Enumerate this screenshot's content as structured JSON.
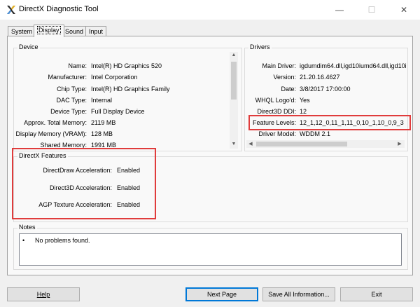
{
  "window": {
    "title": "DirectX Diagnostic Tool",
    "minimize": "—",
    "maximize": "☐",
    "close": "✕"
  },
  "tabs": [
    {
      "label": "System"
    },
    {
      "label": "Display"
    },
    {
      "label": "Sound"
    },
    {
      "label": "Input"
    }
  ],
  "device": {
    "title": "Device",
    "rows": [
      {
        "label": "Name:",
        "value": "Intel(R) HD Graphics 520"
      },
      {
        "label": "Manufacturer:",
        "value": "Intel Corporation"
      },
      {
        "label": "Chip Type:",
        "value": "Intel(R) HD Graphics Family"
      },
      {
        "label": "DAC Type:",
        "value": "Internal"
      },
      {
        "label": "Device Type:",
        "value": "Full Display Device"
      },
      {
        "label": "Approx. Total Memory:",
        "value": "2119 MB"
      },
      {
        "label": "Display Memory (VRAM):",
        "value": "128 MB"
      },
      {
        "label": "Shared Memory:",
        "value": "1991 MB"
      }
    ]
  },
  "drivers": {
    "title": "Drivers",
    "rows": [
      {
        "label": "Main Driver:",
        "value": "igdumdim64.dll,igd10iumd64.dll,igd10iu"
      },
      {
        "label": "Version:",
        "value": "21.20.16.4627"
      },
      {
        "label": "Date:",
        "value": "3/8/2017 17:00:00"
      },
      {
        "label": "WHQL Logo'd:",
        "value": "Yes"
      },
      {
        "label": "Direct3D DDI:",
        "value": "12"
      },
      {
        "label": "Feature Levels:",
        "value": "12_1,12_0,11_1,11_0,10_1,10_0,9_3"
      },
      {
        "label": "Driver Model:",
        "value": "WDDM 2.1"
      }
    ]
  },
  "features": {
    "title": "DirectX Features",
    "rows": [
      {
        "label": "DirectDraw Acceleration:",
        "value": "Enabled"
      },
      {
        "label": "Direct3D Acceleration:",
        "value": "Enabled"
      },
      {
        "label": "AGP Texture Acceleration:",
        "value": "Enabled"
      }
    ]
  },
  "notes": {
    "title": "Notes",
    "items": [
      "No problems found."
    ]
  },
  "buttons": {
    "help": "Help",
    "next_page": "Next Page",
    "save_all": "Save All Information...",
    "exit": "Exit"
  },
  "colors": {
    "highlight": "#e03c3c",
    "default_button": "#0078d7"
  }
}
